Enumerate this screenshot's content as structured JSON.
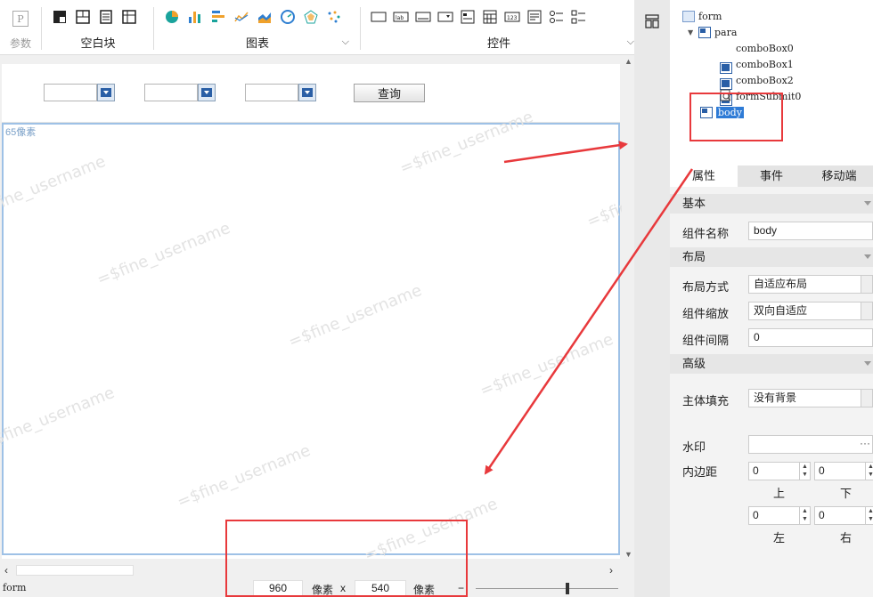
{
  "toolbar": {
    "param_label": "参数",
    "blank_label": "空白块",
    "chart_label": "图表",
    "widget_label": "控件",
    "colors": {
      "chart_blue": "#2f7fd1",
      "chart_orange": "#f0a12b",
      "chart_teal": "#1aa39c"
    }
  },
  "canvas": {
    "query_label": "查询",
    "pixel_hint": "65像素",
    "watermark": "=$fine_username"
  },
  "status": {
    "form_label": "form",
    "width": "960",
    "unit": "像素",
    "times": "x",
    "height": "540",
    "minus": "−"
  },
  "tree": {
    "root": "form",
    "para": "para",
    "children": [
      "comboBox0",
      "comboBox1",
      "comboBox2",
      "formSubmit0"
    ],
    "body": "body"
  },
  "props": {
    "tabs": [
      "属性",
      "事件",
      "移动端"
    ],
    "section_basic": "基本",
    "name_label": "组件名称",
    "name_value": "body",
    "section_layout": "布局",
    "layout_mode_label": "布局方式",
    "layout_mode_value": "自适应布局",
    "scale_label": "组件缩放",
    "scale_value": "双向自适应",
    "gap_label": "组件间隔",
    "gap_value": "0",
    "section_advanced": "高级",
    "fill_label": "主体填充",
    "fill_value": "没有背景",
    "watermark_label": "水印",
    "padding_label": "内边距",
    "pad_top": "0",
    "pad_bottom": "0",
    "pad_left": "0",
    "pad_right": "0",
    "top_label": "上",
    "bottom_label": "下",
    "left_label": "左",
    "right_label": "右"
  },
  "annotation": {
    "color": "#e8393c"
  }
}
